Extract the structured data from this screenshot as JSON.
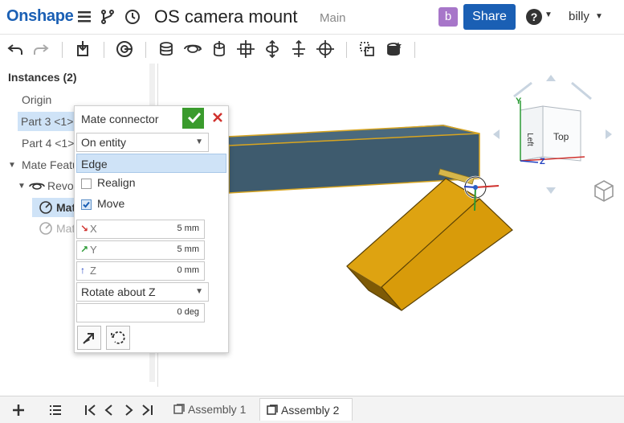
{
  "header": {
    "logo": "Onshape",
    "document_title": "OS camera mount",
    "workspace": "Main",
    "user_initial": "b",
    "share_label": "Share",
    "user_name": "billy",
    "help_glyph": "?"
  },
  "toolbar": {
    "icons": [
      "undo-icon",
      "redo-icon",
      "insert-icon",
      "mate-connector-icon",
      "fastened-mate-icon",
      "revolute-mate-icon",
      "slider-mate-icon",
      "planar-mate-icon",
      "cylindrical-mate-icon",
      "pin-slot-mate-icon",
      "ball-mate-icon",
      "group-icon",
      "replicate-icon"
    ]
  },
  "instances": {
    "title": "Instances (2)",
    "origin": "Origin",
    "part3": "Part 3 <1>",
    "part4": "Part 4 <1>",
    "mate_features": "Mate Featu",
    "revolute": "Revol",
    "mate_a": "Mat",
    "mate_b": "Mat"
  },
  "dialog": {
    "title": "Mate connector",
    "mode": "On entity",
    "selection": "Edge",
    "realign_label": "Realign",
    "realign_checked": false,
    "move_label": "Move",
    "move_checked": true,
    "x_label": "X",
    "x_value": "5 mm",
    "y_label": "Y",
    "y_value": "5 mm",
    "z_label": "Z",
    "z_value": "0 mm",
    "rotate_mode": "Rotate about Z",
    "rotate_value": "0 deg"
  },
  "view_cube": {
    "top_label": "Top",
    "left_label": "Left",
    "axis_y": "Y",
    "axis_z": "Z"
  },
  "bottom": {
    "tabs": [
      {
        "label": "Assembly 1",
        "active": false
      },
      {
        "label": "Assembly 2",
        "active": true
      }
    ]
  },
  "colors": {
    "brand": "#1a5fb4",
    "part_dark": "#3e5b6e",
    "part_gold": "#d89b0a",
    "selection": "#cfe3f7",
    "ok": "#3a9b2d",
    "cancel": "#d0312d"
  }
}
